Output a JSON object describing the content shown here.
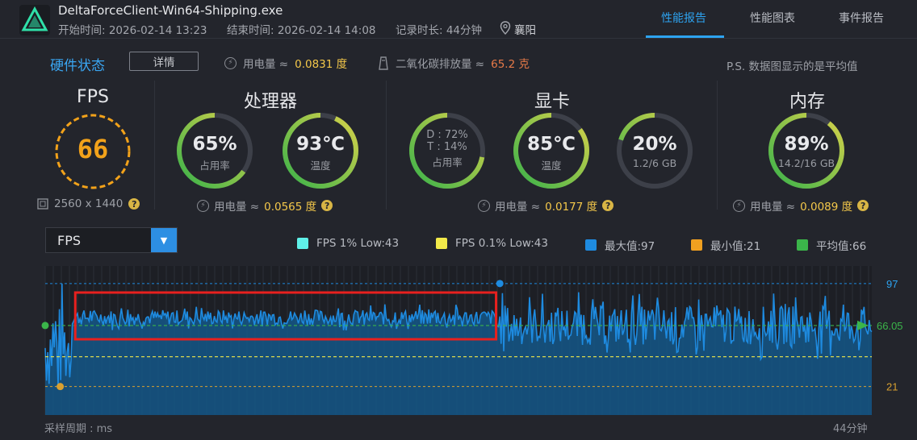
{
  "header": {
    "app_title": "DeltaForceClient-Win64-Shipping.exe",
    "start": "开始时间: 2026-02-14 13:23",
    "end": "结束时间: 2026-02-14 14:08",
    "duration": "记录时长: 44分钟",
    "location": "襄阳",
    "tabs": [
      "性能报告",
      "性能图表",
      "事件报告"
    ],
    "active_tab": 0
  },
  "status": {
    "title": "硬件状态",
    "detail_button": "详情",
    "power_label": "用电量 ≈",
    "power_value": "0.0831 度",
    "co2_label": "二氧化碳排放量 ≈",
    "co2_value": "65.2 克",
    "note": "P.S. 数据图显示的是平均值"
  },
  "sections": {
    "fps": {
      "title": "FPS",
      "value": "66",
      "resolution": "2560 x 1440"
    },
    "cpu": {
      "title": "处理器",
      "usage": "65%",
      "usage_label": "占用率",
      "usage_fraction": 0.65,
      "temp": "93℃",
      "temp_label": "温度",
      "temp_fraction": 0.93,
      "power_label": "用电量 ≈",
      "power_value": "0.0565 度"
    },
    "gpu": {
      "title": "显卡",
      "d_line": "D : 72%",
      "t_line": "T : 14%",
      "usage_label": "占用率",
      "usage_fraction": 0.72,
      "temp": "85℃",
      "temp_label": "温度",
      "temp_fraction": 0.85,
      "vram": "20%",
      "vram_sub": "1.2/6 GB",
      "vram_fraction": 0.2,
      "power_label": "用电量 ≈",
      "power_value": "0.0177 度"
    },
    "mem": {
      "title": "内存",
      "usage": "89%",
      "usage_sub": "14.2/16 GB",
      "usage_fraction": 0.89,
      "power_label": "用电量 ≈",
      "power_value": "0.0089 度"
    }
  },
  "chart_header": {
    "select_value": "FPS",
    "legend": [
      {
        "label": "FPS 1% Low:43",
        "color": "#5ff0e8"
      },
      {
        "label": "FPS 0.1% Low:43",
        "color": "#f2ea4a"
      },
      {
        "label": "最大值:97",
        "color": "#1e8be0"
      },
      {
        "label": "最小值:21",
        "color": "#f0a020"
      },
      {
        "label": "平均值:66",
        "color": "#3bb54a"
      }
    ]
  },
  "chart_data": {
    "type": "area",
    "y_max": 97,
    "y_min": 21,
    "y_avg": 66.05,
    "y_1pct_low": 43,
    "max_label": "97",
    "min_label": "21",
    "avg_label": "66.05",
    "x_start_label": "采样周期 : ms",
    "x_end_label": "44分钟",
    "duration_minutes": 44,
    "segments": [
      {
        "from_min": 0,
        "to_min": 1.4,
        "level": 50,
        "spread": 40
      },
      {
        "from_min": 1.4,
        "to_min": 24,
        "level": 72,
        "spread": 7
      },
      {
        "from_min": 24,
        "to_min": 44,
        "level": 66,
        "spread": 18
      }
    ],
    "highlight_from_min": 1.6,
    "highlight_to_min": 24.0,
    "colors": {
      "line": "#1e8be0",
      "fill": "#145788",
      "avg": "#3bb54a",
      "low": "#f2ea4a",
      "max": "#1e8be0",
      "min": "#d8a030"
    }
  }
}
